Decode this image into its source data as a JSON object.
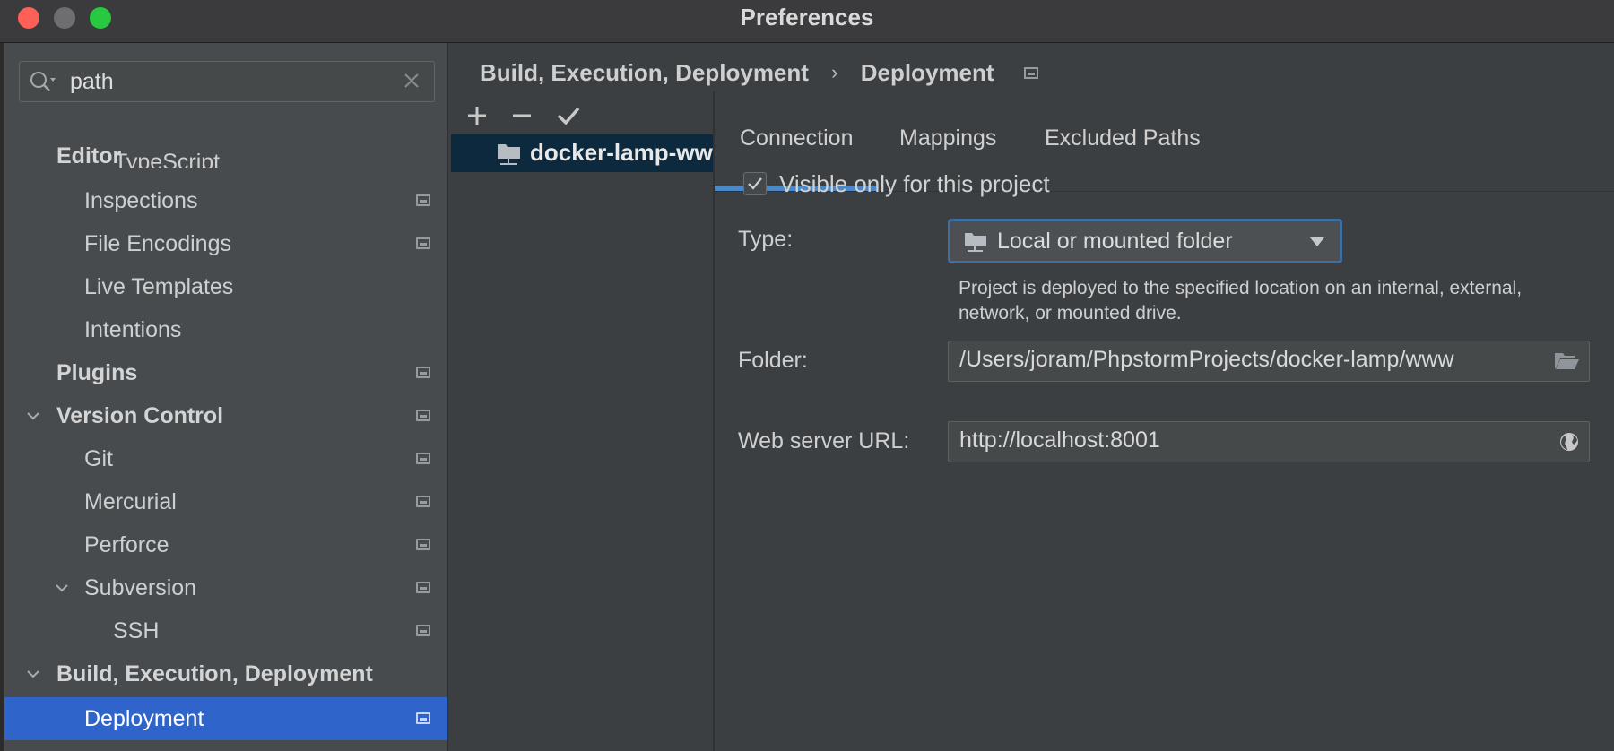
{
  "window": {
    "title": "Preferences"
  },
  "sidebar": {
    "search": {
      "value": "path"
    },
    "items": [
      {
        "label": "Editor"
      },
      {
        "label": "TypeScript"
      },
      {
        "label": "Inspections"
      },
      {
        "label": "File Encodings"
      },
      {
        "label": "Live Templates"
      },
      {
        "label": "Intentions"
      },
      {
        "label": "Plugins"
      },
      {
        "label": "Version Control"
      },
      {
        "label": "Git"
      },
      {
        "label": "Mercurial"
      },
      {
        "label": "Perforce"
      },
      {
        "label": "Subversion"
      },
      {
        "label": "SSH"
      },
      {
        "label": "Build, Execution, Deployment"
      },
      {
        "label": "Deployment"
      }
    ]
  },
  "breadcrumb": {
    "parent": "Build, Execution, Deployment",
    "separator": "›",
    "current": "Deployment"
  },
  "servers": [
    {
      "name": "docker-lamp-www"
    }
  ],
  "tabs": [
    {
      "label": "Connection",
      "active": true
    },
    {
      "label": "Mappings"
    },
    {
      "label": "Excluded Paths"
    }
  ],
  "form": {
    "visible_only": {
      "label": "Visible only for this project",
      "checked": true
    },
    "type": {
      "label": "Type:",
      "value": "Local or mounted folder",
      "hint": "Project is deployed to the specified location on an internal, external, network, or mounted drive."
    },
    "folder": {
      "label": "Folder:",
      "value": "/Users/joram/PhpstormProjects/docker-lamp/www"
    },
    "web_url": {
      "label": "Web server URL:",
      "value": "http://localhost:8001"
    }
  },
  "colors": {
    "selection": "#2f65ca",
    "accent": "#4a88c7",
    "server_row": "#0d293e"
  }
}
